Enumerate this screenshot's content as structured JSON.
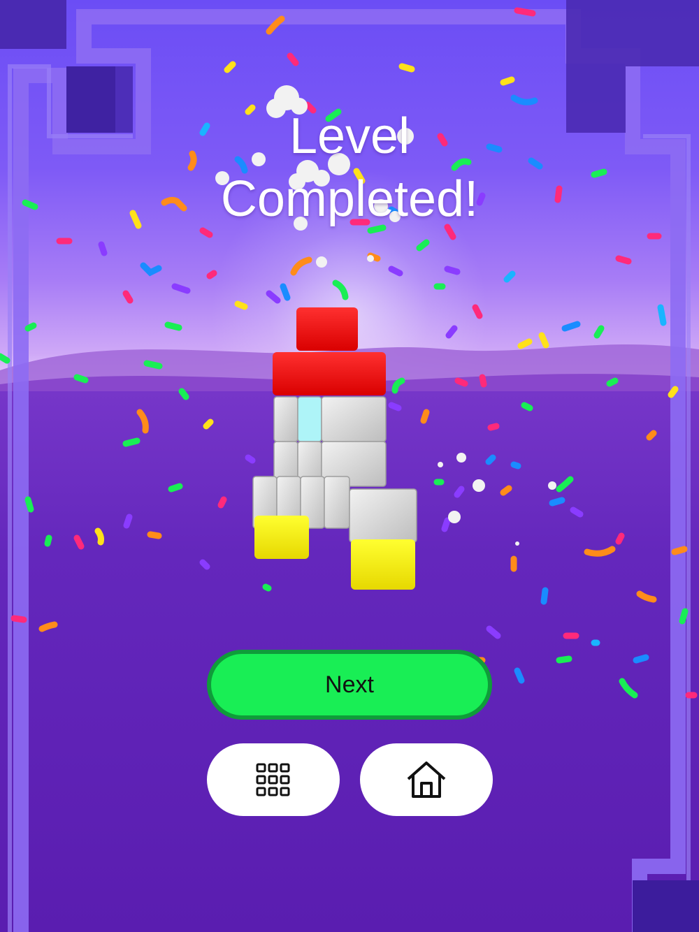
{
  "screen": {
    "title_line1": "Level",
    "title_line2": "Completed!"
  },
  "buttons": {
    "next_label": "Next",
    "levels_icon": "grid-icon",
    "home_icon": "home-icon"
  },
  "colors": {
    "next_button": "#19ee55",
    "next_border": "#0f9c3a",
    "sky_top": "#6b4df5",
    "ground": "#5a1fae",
    "block_red": "#ff1010",
    "block_gray": "#d9d9d9",
    "block_cyan": "#aef4f8",
    "block_yellow": "#ffff00"
  }
}
